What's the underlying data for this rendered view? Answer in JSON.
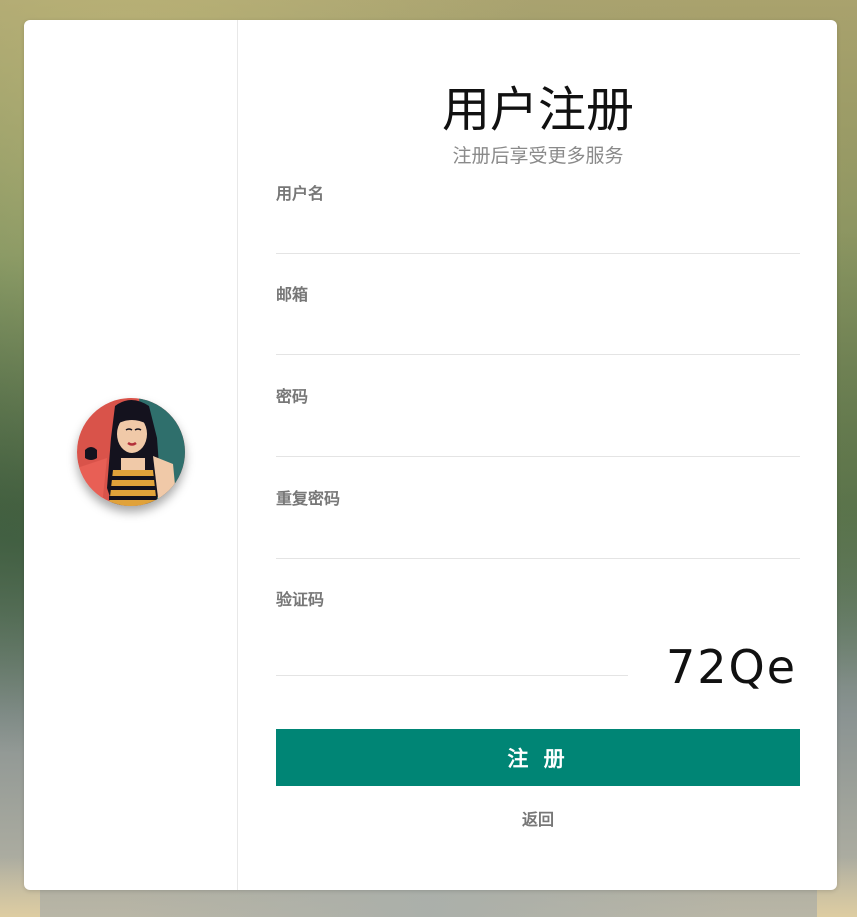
{
  "page": {
    "title": "用户注册",
    "subtitle": "注册后享受更多服务"
  },
  "form": {
    "username_label": "用户名",
    "email_label": "邮箱",
    "password_label": "密码",
    "confirm_password_label": "重复密码",
    "captcha_label": "验证码",
    "captcha_text": "72Qe",
    "submit_label": "注 册",
    "back_label": "返回"
  },
  "colors": {
    "accent": "#008575",
    "label": "#777777",
    "subtitle": "#8a8a8a",
    "divider": "#e4e4e4"
  },
  "icons": {
    "avatar": "illustrated-woman-avatar"
  }
}
